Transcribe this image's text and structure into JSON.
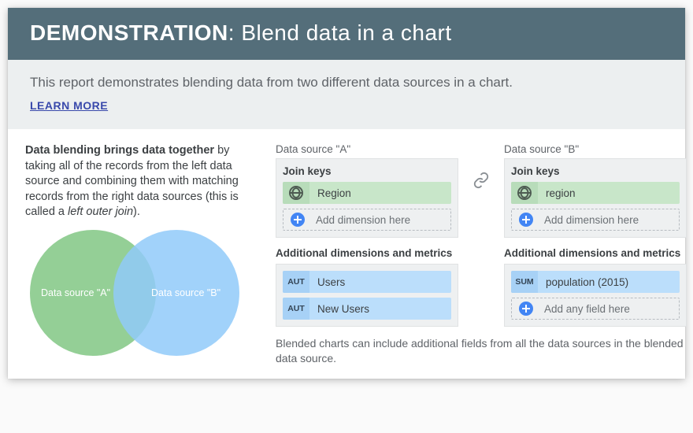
{
  "header": {
    "strong": "DEMONSTRATION",
    "colon": ": ",
    "rest": "Blend data in a chart"
  },
  "sub": {
    "text": "This report demonstrates blending data from two different data sources in a chart.",
    "learn_more": "LEARN MORE"
  },
  "blurb": {
    "strong": "Data blending brings data together",
    "body": " by taking all of the records from the left data source and combining them with matching records from the right data sources (this is called a ",
    "italic": "left outer join",
    "tail": ")."
  },
  "venn": {
    "a": "Data source \"A\"",
    "b": "Data source \"B\""
  },
  "panel_a": {
    "title": "Data source \"A\"",
    "join_label": "Join keys",
    "join_field": "Region",
    "add_dim": "Add dimension here",
    "extra_label": "Additional dimensions and metrics",
    "fields": [
      {
        "badge": "AUT",
        "label": "Users"
      },
      {
        "badge": "AUT",
        "label": "New Users"
      }
    ]
  },
  "panel_b": {
    "title": "Data source \"B\"",
    "join_label": "Join keys",
    "join_field": "region",
    "add_dim": "Add dimension here",
    "extra_label": "Additional dimensions and metrics",
    "field_badge": "SUM",
    "field_label": "population (2015)",
    "add_any": "Add any field here"
  },
  "caption": "Blended charts can include additional fields from all the data sources in the blended data source."
}
